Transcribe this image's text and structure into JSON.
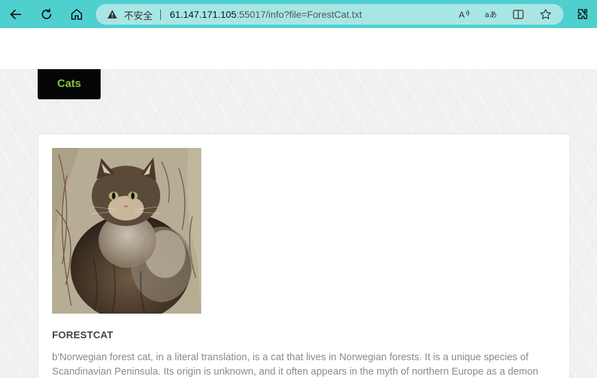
{
  "browser": {
    "security_label": "不安全",
    "url_host": "61.147.171.105",
    "url_rest": ":55017/info?file=ForestCat.txt",
    "icons": [
      "back-icon",
      "refresh-icon",
      "home-icon",
      "warning-icon",
      "read-aloud-icon",
      "translate-icon",
      "split-screen-icon",
      "favorite-star-icon",
      "extensions-icon"
    ],
    "accent_color": "#4fd0cf"
  },
  "page": {
    "nav_button_label": "Cats",
    "nav_button_color": "#8dc63f",
    "card": {
      "title": "FORESTCAT",
      "text": "b'Norwegian forest cat, in a literal translation, is a cat that lives in Norwegian forests. It is a unique species of Scandinavian Peninsula. Its origin is unknown, and it often appears in the myth of northern Europe as a demon"
    }
  }
}
